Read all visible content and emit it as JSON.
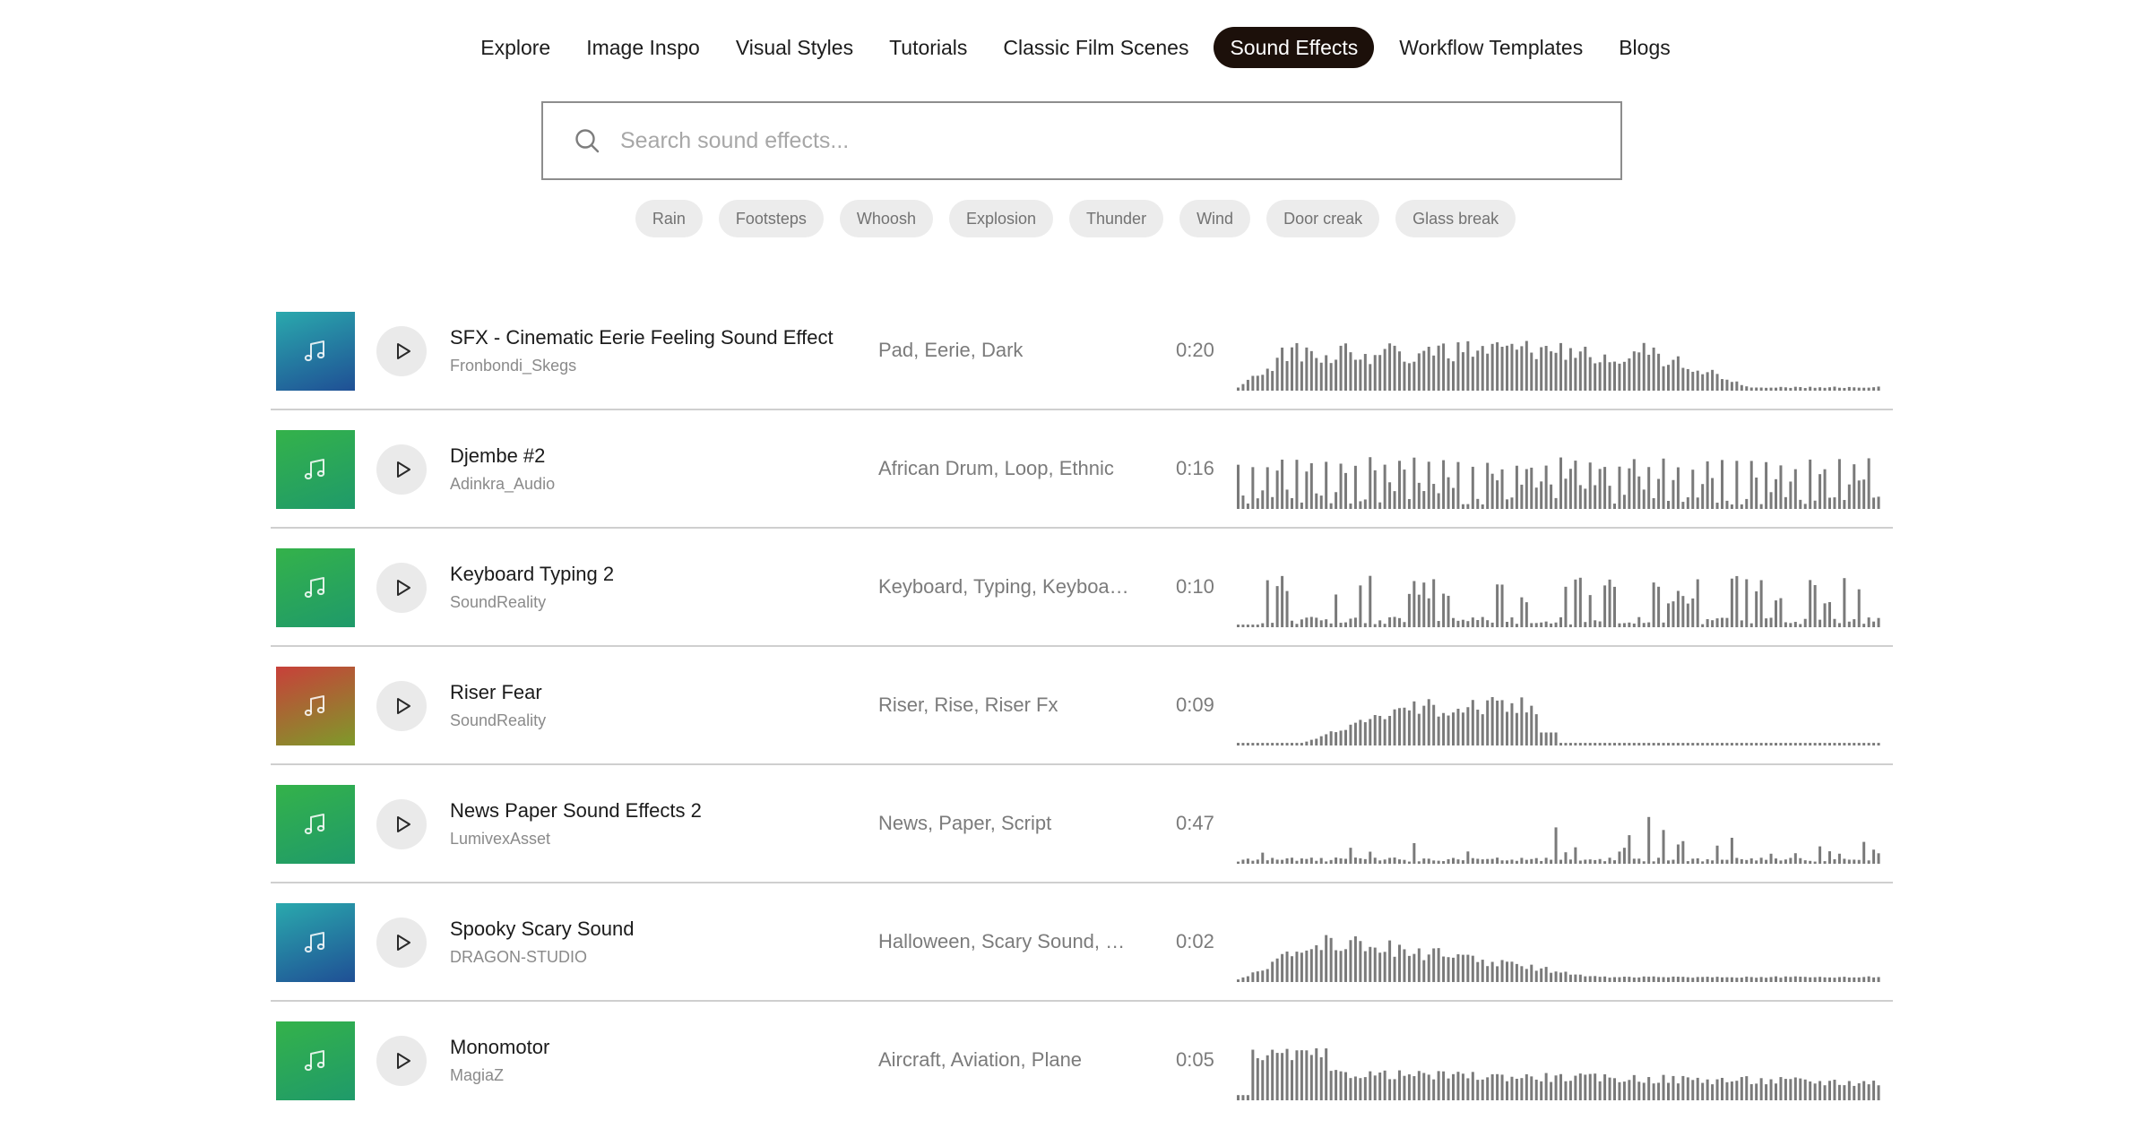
{
  "nav": {
    "items": [
      {
        "label": "Explore",
        "active": false
      },
      {
        "label": "Image Inspo",
        "active": false
      },
      {
        "label": "Visual Styles",
        "active": false
      },
      {
        "label": "Tutorials",
        "active": false
      },
      {
        "label": "Classic Film Scenes",
        "active": false
      },
      {
        "label": "Sound Effects",
        "active": true
      },
      {
        "label": "Workflow Templates",
        "active": false
      },
      {
        "label": "Blogs",
        "active": false
      }
    ]
  },
  "search": {
    "placeholder": "Search sound effects...",
    "value": ""
  },
  "chips": [
    "Rain",
    "Footsteps",
    "Whoosh",
    "Explosion",
    "Thunder",
    "Wind",
    "Door creak",
    "Glass break"
  ],
  "colors": {
    "teal_blue": [
      "#2aa9ad",
      "#1f4f95"
    ],
    "green": [
      "#34b24a",
      "#1f9a6a"
    ],
    "red_olive": [
      "#c8403a",
      "#7e9a2a"
    ],
    "wave": "#7a7a7a",
    "nav_active_bg": "#1c100a"
  },
  "sounds": [
    {
      "title": "SFX - Cinematic Eerie Feeling Sound Effect",
      "author": "Fronbondi_Skegs",
      "tags": "Pad, Eerie, Dark",
      "duration": "0:20",
      "thumb": "teal_blue",
      "icon": "music-note-icon",
      "wave": "eerie"
    },
    {
      "title": "Djembe #2",
      "author": "Adinkra_Audio",
      "tags": "African Drum, Loop, Ethnic",
      "duration": "0:16",
      "thumb": "green",
      "icon": "music-note-icon",
      "wave": "djembe"
    },
    {
      "title": "Keyboard Typing 2",
      "author": "SoundReality",
      "tags": "Keyboard, Typing, Keyboar...",
      "duration": "0:10",
      "thumb": "green",
      "icon": "music-note-icon",
      "wave": "typing"
    },
    {
      "title": "Riser Fear",
      "author": "SoundReality",
      "tags": "Riser, Rise, Riser Fx",
      "duration": "0:09",
      "thumb": "red_olive",
      "icon": "music-note-icon",
      "wave": "riser"
    },
    {
      "title": "News Paper Sound Effects 2",
      "author": "LumivexAsset",
      "tags": "News, Paper, Script",
      "duration": "0:47",
      "thumb": "green",
      "icon": "music-note-icon",
      "wave": "paper"
    },
    {
      "title": "Spooky Scary Sound",
      "author": "DRAGON-STUDIO",
      "tags": "Halloween, Scary Sound, C...",
      "duration": "0:02",
      "thumb": "teal_blue",
      "icon": "music-note-icon",
      "wave": "spooky"
    },
    {
      "title": "Monomotor",
      "author": "MagiaZ",
      "tags": "Aircraft, Aviation, Plane",
      "duration": "0:05",
      "thumb": "green",
      "icon": "music-note-icon",
      "wave": "motor"
    }
  ]
}
